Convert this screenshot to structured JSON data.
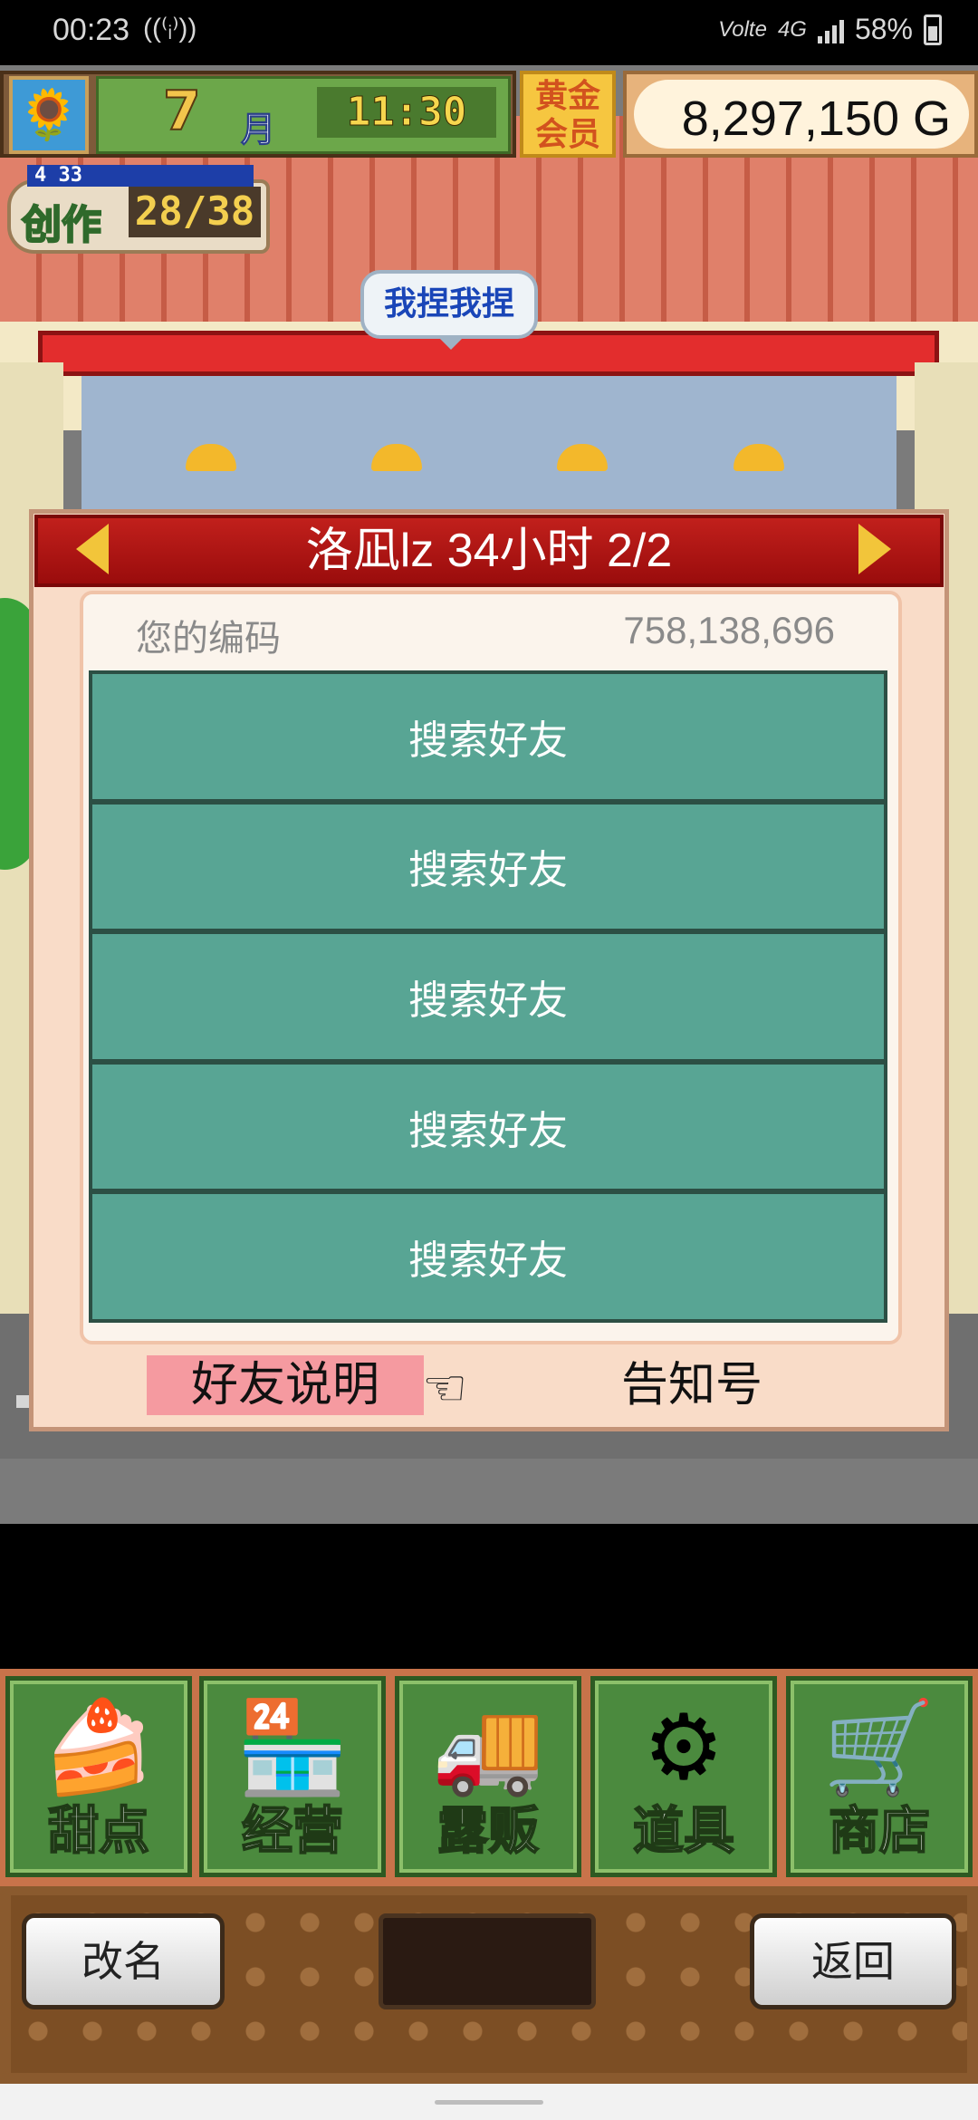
{
  "status_bar": {
    "time": "00:23",
    "call_icon": "wifi-call-icon",
    "network": "Volte",
    "data_type": "4G",
    "battery": "58%"
  },
  "hud": {
    "month_number": "7",
    "month_unit": "月",
    "clock": "11:30",
    "member_label": "黄金会员",
    "gold": "8,297,150 G",
    "level_label": "4 33",
    "create_label": "创作",
    "create_count": "28/38",
    "avatar_icon": "sunflower-icon"
  },
  "speech_bubble": "我捏我捏",
  "dialog": {
    "title": "洛凪lz  34小时 2/2",
    "code_label": "您的编码",
    "code_value": "758,138,696",
    "slots": [
      {
        "label": "搜索好友"
      },
      {
        "label": "搜索好友"
      },
      {
        "label": "搜索好友"
      },
      {
        "label": "搜索好友"
      },
      {
        "label": "搜索好友"
      }
    ],
    "help_button": "好友说明",
    "notice_button": "告知号",
    "pointer_icon": "pointing-hand-icon"
  },
  "menu": [
    {
      "label": "甜点",
      "icon": "cake-icon",
      "glyph": "🍰"
    },
    {
      "label": "经营",
      "icon": "shop-building-icon",
      "glyph": "🏪"
    },
    {
      "label": "露贩",
      "icon": "food-truck-icon",
      "glyph": "🚚"
    },
    {
      "label": "道具",
      "icon": "gear-bag-icon",
      "glyph": "⚙"
    },
    {
      "label": "商店",
      "icon": "shopping-cart-icon",
      "glyph": "🛒"
    }
  ],
  "bottom": {
    "rename": "改名",
    "back": "返回"
  },
  "colors": {
    "dialog_header": "#b0161a",
    "slot_green": "#58a594",
    "help_highlight": "#f59aa0"
  }
}
